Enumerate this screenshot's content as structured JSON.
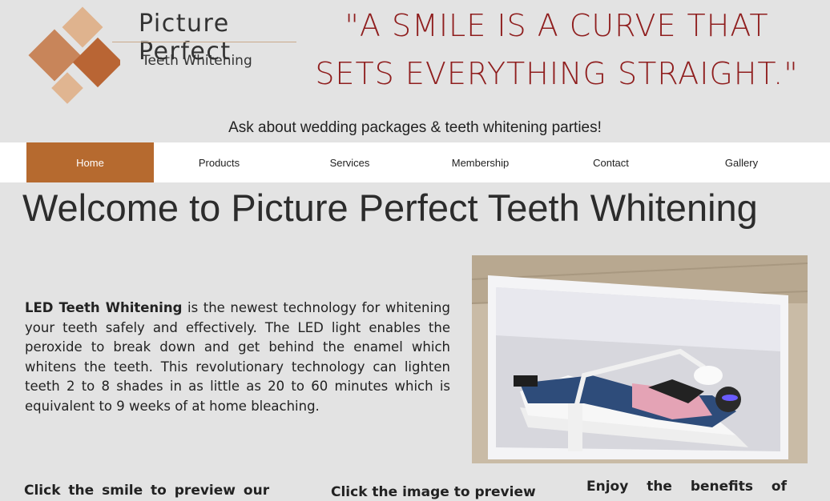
{
  "header": {
    "logo_title": "Picture Perfect",
    "logo_subtitle": "Teeth Whitening",
    "quote_line1": "\"A SMILE IS A CURVE THAT",
    "quote_line2": "SETS EVERYTHING STRAIGHT.\"",
    "tagline": "Ask about wedding packages & teeth whitening parties!"
  },
  "nav": {
    "items": [
      {
        "label": "Home"
      },
      {
        "label": "Products"
      },
      {
        "label": "Services"
      },
      {
        "label": "Membership"
      },
      {
        "label": "Contact"
      },
      {
        "label": "Gallery"
      }
    ]
  },
  "main": {
    "title": "Welcome to Picture Perfect Teeth Whitening",
    "intro_bold": "LED Teeth Whitening",
    "intro_text": " is the newest technology for whitening your teeth safely and effectively. The LED light enables the peroxide to break down and get behind the enamel which whitens the teeth. This revolutionary technology can lighten teeth 2 to 8 shades in as little as 20 to 60 minutes which is equivalent to 9 weeks of at home bleaching.",
    "bottom_col1": "Click the smile to preview our",
    "bottom_col2": "Click the image to preview",
    "bottom_col3": "Enjoy the benefits of"
  },
  "colors": {
    "accent": "#b66a2f",
    "quote": "#8f1e1e",
    "background": "#e3e3e3"
  }
}
